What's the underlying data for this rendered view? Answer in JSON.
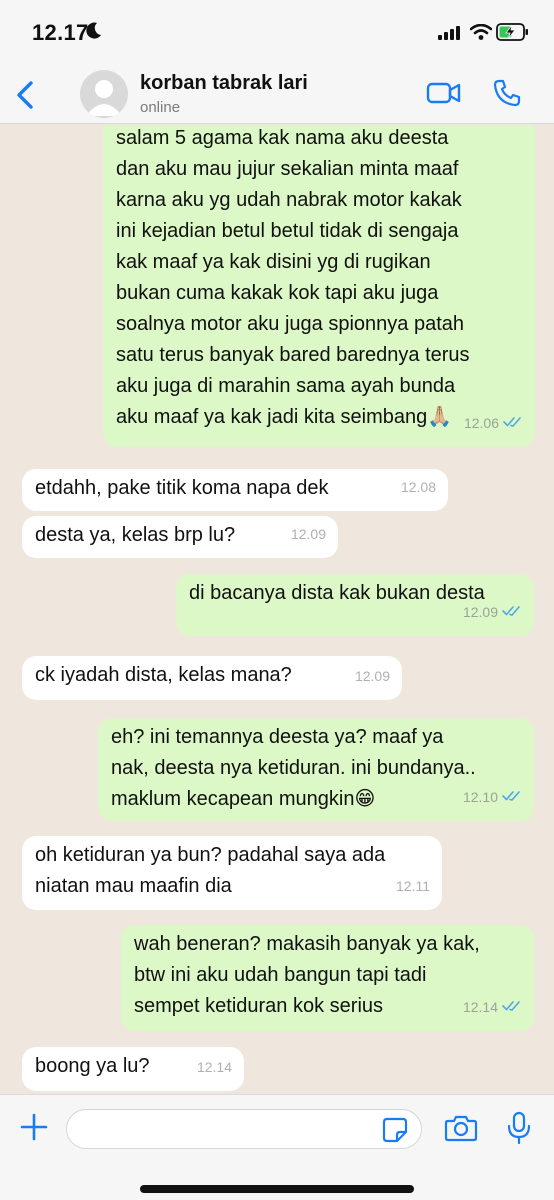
{
  "status_bar": {
    "time": "12.17"
  },
  "header": {
    "contact_name": "korban tabrak lari",
    "status": "online"
  },
  "messages": [
    {
      "direction": "out",
      "text": "salam 5 agama kak nama aku deesta\ndan aku mau jujur sekalian minta maaf\nkarna aku yg udah nabrak motor kakak\nini kejadian betul betul tidak di sengaja\nkak maaf ya kak disini yg di rugikan\nbukan cuma kakak kok tapi aku juga\nsoalnya motor aku juga spionnya patah\nsatu terus banyak bared barednya terus\naku juga di marahin sama ayah bunda\naku maaf ya kak jadi kita seimbang🙏🏼",
      "time": "12.06",
      "read": true
    },
    {
      "direction": "in",
      "text": "etdahh, pake titik koma napa dek",
      "time": "12.08"
    },
    {
      "direction": "in",
      "text": "desta ya, kelas brp lu?",
      "time": "12.09"
    },
    {
      "direction": "out",
      "text": "di bacanya dista kak bukan desta",
      "time": "12.09",
      "read": true
    },
    {
      "direction": "in",
      "text": "ck iyadah dista, kelas mana?",
      "time": "12.09"
    },
    {
      "direction": "out",
      "text": "eh? ini temannya deesta ya? maaf ya\nnak, deesta nya ketiduran. ini bundanya..\nmaklum kecapean mungkin😁",
      "time": "12.10",
      "read": true
    },
    {
      "direction": "in",
      "text": "oh ketiduran ya bun? padahal saya ada\nniatan mau maafin dia",
      "time": "12.11"
    },
    {
      "direction": "out",
      "text": "wah beneran? makasih banyak ya kak,\nbtw ini aku udah bangun tapi tadi\nsempet ketiduran kok serius",
      "time": "12.14",
      "read": true
    },
    {
      "direction": "in",
      "text": "boong ya lu?",
      "time": "12.14"
    }
  ],
  "input_bar": {
    "placeholder": ""
  },
  "colors": {
    "outgoing_bubble": "#dcf8c6",
    "incoming_bubble": "#ffffff",
    "accent_blue": "#1a7cf5",
    "chat_background": "#efe7de"
  }
}
